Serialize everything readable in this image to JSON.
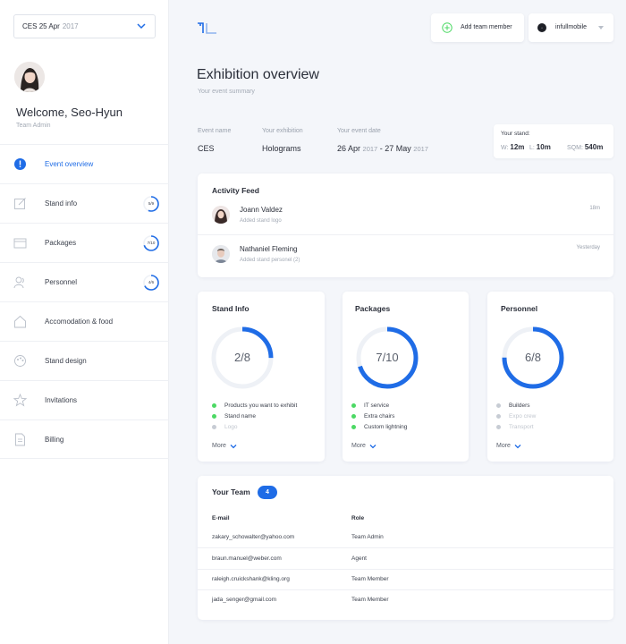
{
  "date_select": {
    "event": "CES",
    "date": "25 Apr",
    "year": "2017"
  },
  "user": {
    "welcome": "Welcome, Seo-Hyun",
    "role": "Team Admin"
  },
  "nav": {
    "items": [
      {
        "label": "Event overview",
        "icon": "info-circle-icon",
        "active": true
      },
      {
        "label": "Stand info",
        "icon": "edit-icon",
        "progress_text": "5/9",
        "progress": 0.56
      },
      {
        "label": "Packages",
        "icon": "package-icon",
        "progress_text": "7/10",
        "progress": 0.7
      },
      {
        "label": "Personnel",
        "icon": "people-icon",
        "progress_text": "4/6",
        "progress": 0.67
      },
      {
        "label": "Accomodation & food",
        "icon": "house-icon"
      },
      {
        "label": "Stand design",
        "icon": "palette-icon"
      },
      {
        "label": "Invitations",
        "icon": "star-icon"
      },
      {
        "label": "Billing",
        "icon": "document-icon"
      }
    ]
  },
  "topbar": {
    "add_member": "Add team member",
    "account": "infullmobile"
  },
  "page": {
    "title": "Exhibition overview",
    "subtitle": "Your event summary"
  },
  "event": {
    "name_label": "Event name",
    "name": "CES",
    "exhibition_label": "Your exhibition",
    "exhibition": "Holograms",
    "date_label": "Your event date",
    "date_start": "26 Apr",
    "date_start_year": "2017",
    "date_sep": "- 27 May",
    "date_end_year": "2017"
  },
  "stand": {
    "title": "Your stand:",
    "w_label": "W:",
    "w": "12m",
    "l_label": "L:",
    "l": "10m",
    "sqm_label": "SQM:",
    "sqm": "540m"
  },
  "activity": {
    "title": "Activity Feed",
    "items": [
      {
        "name": "Joann Valdez",
        "desc": "Added stand logo",
        "time": "18m"
      },
      {
        "name": "Nathaniel Fleming",
        "desc": "Added stand personel (2)",
        "time": "Yesterday"
      }
    ]
  },
  "summary_cards": [
    {
      "title": "Stand Info",
      "value_text": "2/8",
      "progress": 0.25,
      "more": "More",
      "items": [
        {
          "label": "Products you want to exhibit",
          "done": true
        },
        {
          "label": "Stand name",
          "done": true
        },
        {
          "label": "Logo",
          "done": false
        }
      ]
    },
    {
      "title": "Packages",
      "value_text": "7/10",
      "progress": 0.7,
      "more": "More",
      "items": [
        {
          "label": "IT service",
          "done": true
        },
        {
          "label": "Extra chairs",
          "done": true
        },
        {
          "label": "Custom lightning",
          "done": true
        }
      ]
    },
    {
      "title": "Personnel",
      "value_text": "6/8",
      "progress": 0.75,
      "more": "More",
      "items": [
        {
          "label": "Builders",
          "done": false
        },
        {
          "label": "Expo crew",
          "done": false
        },
        {
          "label": "Transport",
          "done": false
        }
      ]
    }
  ],
  "team": {
    "title": "Your Team",
    "count": "4",
    "columns": [
      "E-mail",
      "Role"
    ],
    "rows": [
      {
        "email": "zakary_schowalter@yahoo.com",
        "role": "Team Admin"
      },
      {
        "email": "braun.manuel@weber.com",
        "role": "Agent"
      },
      {
        "email": "raleigh.cruickshank@kling.org",
        "role": "Team Member"
      },
      {
        "email": "jada_senger@gmail.com",
        "role": "Team Member"
      }
    ]
  },
  "colors": {
    "accent": "#1f6ce6",
    "done": "#4cd964",
    "pending": "#c7ccd4",
    "ring_track": "#eef1f6"
  }
}
